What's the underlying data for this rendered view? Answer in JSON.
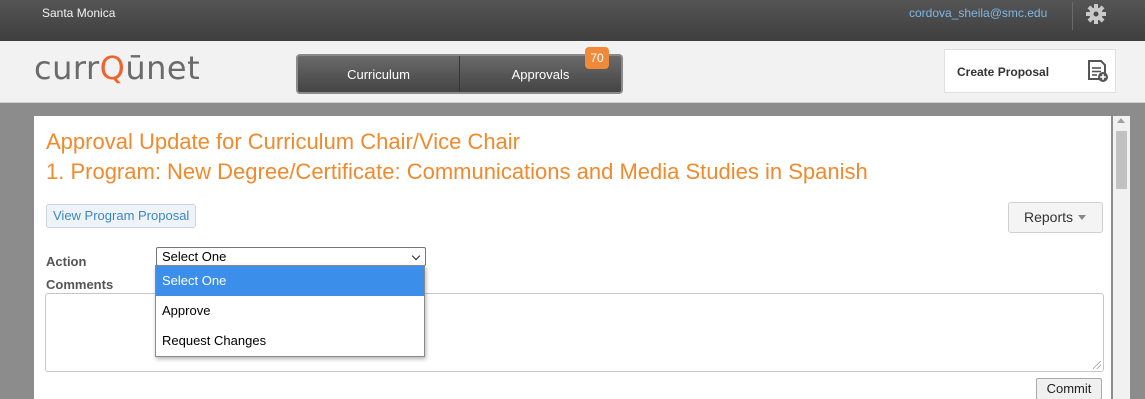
{
  "topbar": {
    "institution": "Santa Monica",
    "user_email": "cordova_sheila@smc.edu",
    "settings_icon": "gear-icon"
  },
  "header": {
    "logo_prefix": "curr",
    "logo_q": "Q",
    "logo_suffix": "ūnet",
    "tabs": [
      {
        "label": "Curriculum"
      },
      {
        "label": "Approvals"
      }
    ],
    "approvals_badge": "70",
    "create_proposal_label": "Create Proposal",
    "create_proposal_icon": "document-add-icon"
  },
  "main": {
    "title": "Approval Update for Curriculum Chair/Vice Chair",
    "subtitle": "1. Program: New Degree/Certificate: Communications and Media Studies in Spanish",
    "view_proposal_label": "View Program Proposal",
    "reports_label": "Reports",
    "action_label": "Action",
    "comments_label": "Comments",
    "action_select_value": "Select One",
    "action_options": [
      "Select One",
      "Approve",
      "Request Changes"
    ],
    "comments_value": "",
    "commit_label": "Commit"
  },
  "colors": {
    "accent": "#f08a2c",
    "logo_q": "#f0632a",
    "link": "#3d86c4",
    "selected_option": "#3b8eea",
    "badge": "#f08a3a"
  }
}
